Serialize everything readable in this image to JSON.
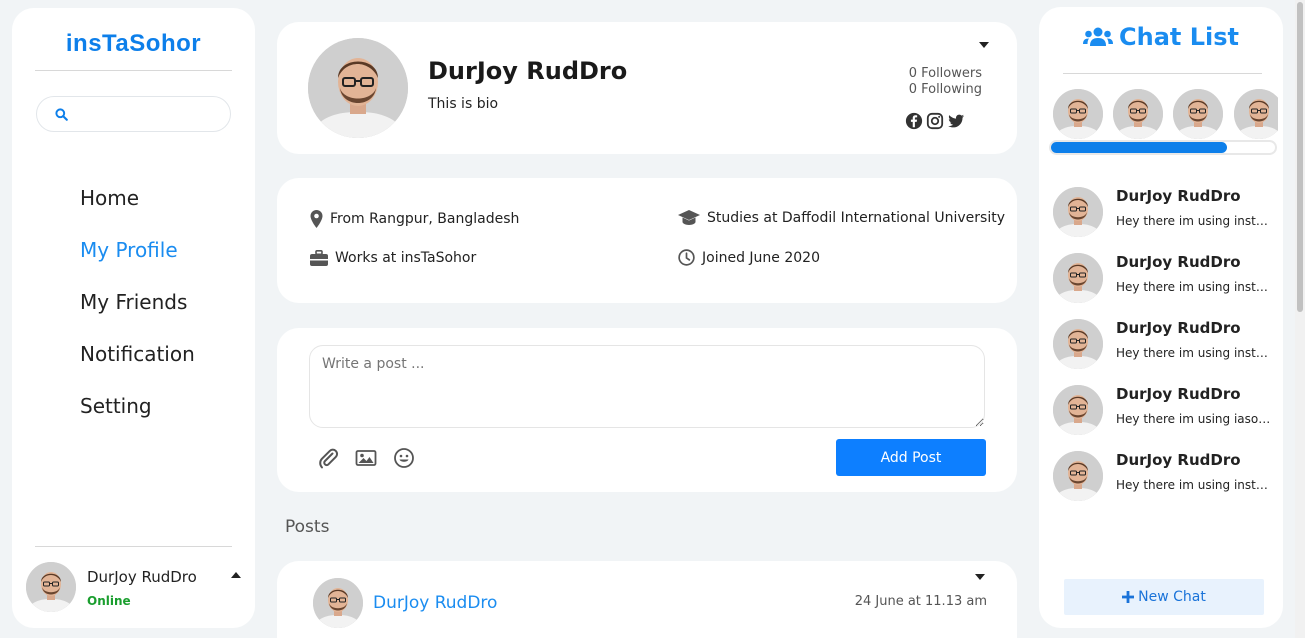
{
  "brand": {
    "name": "insTaSohor",
    "color": "#0d7fea"
  },
  "search": {
    "placeholder": ""
  },
  "nav": [
    {
      "label": "Home",
      "active": false
    },
    {
      "label": "My Profile",
      "active": true
    },
    {
      "label": "My Friends",
      "active": false
    },
    {
      "label": "Notification",
      "active": false
    },
    {
      "label": "Setting",
      "active": false
    }
  ],
  "current_user": {
    "name": "DurJoy RudDro",
    "status": "Online"
  },
  "profile": {
    "name": "DurJoy RudDro",
    "bio": "This is bio",
    "followers": "0 Followers",
    "following": "0 Following",
    "socials": [
      "facebook-icon",
      "instagram-icon",
      "twitter-icon"
    ]
  },
  "info": {
    "from": "From Rangpur, Bangladesh",
    "studies": "Studies at Daffodil International University",
    "works": "Works at insTaSohor",
    "joined": "Joined June 2020"
  },
  "composer": {
    "placeholder": "Write a post ...",
    "button": "Add Post"
  },
  "posts": {
    "title": "Posts",
    "items": [
      {
        "author": "DurJoy RudDro",
        "time": "24 June at 11.13 am"
      }
    ]
  },
  "chat": {
    "title": "Chat List",
    "items": [
      {
        "name": "DurJoy RudDro",
        "message": "Hey there im using instasohor"
      },
      {
        "name": "DurJoy RudDro",
        "message": "Hey there im using instasohor"
      },
      {
        "name": "DurJoy RudDro",
        "message": "Hey there im using instasohor"
      },
      {
        "name": "DurJoy RudDro",
        "message": "Hey there im using iasohor"
      },
      {
        "name": "DurJoy RudDro",
        "message": "Hey there im using instasohor"
      }
    ],
    "new_chat": "New Chat"
  },
  "colors": {
    "accent": "#0d7fff",
    "online": "#1a9e2e",
    "background": "#f1f4f6"
  }
}
